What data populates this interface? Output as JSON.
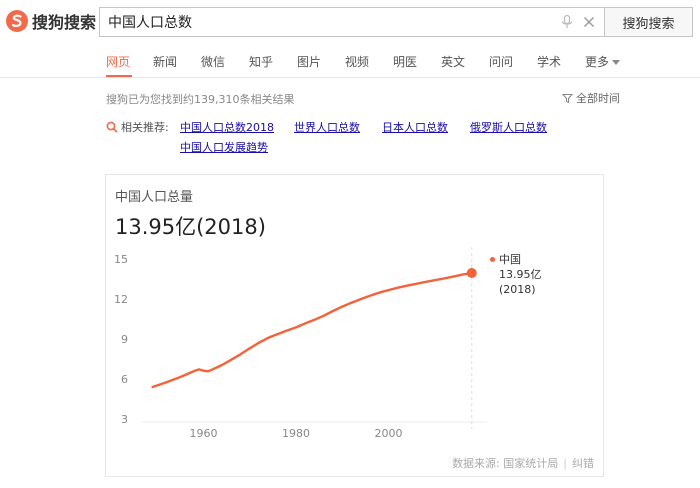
{
  "header": {
    "logo_text": "搜狗搜索",
    "search_value": "中国人口总数",
    "search_button": "搜狗搜索"
  },
  "tabs": [
    {
      "label": "网页",
      "active": true
    },
    {
      "label": "新闻"
    },
    {
      "label": "微信"
    },
    {
      "label": "知乎"
    },
    {
      "label": "图片"
    },
    {
      "label": "视频"
    },
    {
      "label": "明医"
    },
    {
      "label": "英文"
    },
    {
      "label": "问问"
    },
    {
      "label": "学术"
    },
    {
      "label": "更多"
    }
  ],
  "results": {
    "count_text": "搜狗已为您找到约139,310条相关结果",
    "filter_label": "全部时间"
  },
  "related": {
    "label": "相关推荐:",
    "links": [
      "中国人口总数2018",
      "世界人口总数",
      "日本人口总数",
      "俄罗斯人口总数",
      "中国人口发展趋势"
    ]
  },
  "card": {
    "title": "中国人口总量",
    "value": "13.95亿(2018)",
    "source_label": "数据来源:",
    "source_name": "国家统计局",
    "feedback": "纠错",
    "legend": {
      "country": "中国",
      "value": "13.95亿",
      "year": "(2018)"
    }
  },
  "colors": {
    "accent": "#f26a4a",
    "line": "#f4623a",
    "link": "#1a0dab"
  },
  "chart_data": {
    "type": "line",
    "title": "中国人口总量",
    "xlabel": "",
    "ylabel": "",
    "x_ticks": [
      1960,
      1980,
      2000
    ],
    "y_ticks": [
      3,
      6,
      9,
      12,
      15
    ],
    "xlim": [
      1948,
      2020
    ],
    "ylim": [
      3,
      15
    ],
    "grid": false,
    "series": [
      {
        "name": "中国",
        "x": [
          1949,
          1952,
          1955,
          1958,
          1959,
          1960,
          1961,
          1962,
          1964,
          1966,
          1968,
          1970,
          1972,
          1974,
          1976,
          1978,
          1980,
          1982,
          1984,
          1986,
          1988,
          1990,
          1992,
          1994,
          1996,
          1998,
          2000,
          2002,
          2004,
          2006,
          2008,
          2010,
          2012,
          2014,
          2016,
          2018
        ],
        "values": [
          5.4,
          5.75,
          6.15,
          6.6,
          6.72,
          6.62,
          6.58,
          6.73,
          7.05,
          7.45,
          7.85,
          8.3,
          8.72,
          9.09,
          9.37,
          9.63,
          9.87,
          10.17,
          10.44,
          10.75,
          11.1,
          11.43,
          11.72,
          11.99,
          12.24,
          12.48,
          12.67,
          12.85,
          13.0,
          13.14,
          13.28,
          13.41,
          13.54,
          13.68,
          13.83,
          13.95
        ]
      }
    ],
    "highlight": {
      "x": 2018,
      "y": 13.95
    }
  }
}
